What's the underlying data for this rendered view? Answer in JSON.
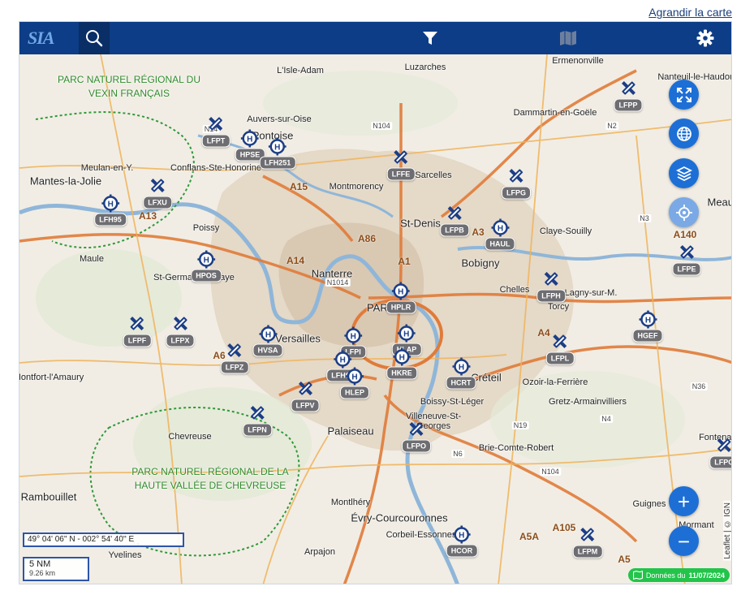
{
  "header": {
    "enlarge_link": "Agrandir la carte",
    "logo_text": "SIA"
  },
  "toolbar": {
    "search_icon": "search-icon",
    "filter_icon": "filter-icon",
    "map_icon": "map-icon",
    "settings_icon": "gear-icon"
  },
  "map": {
    "coordinates": "49° 04' 06'' N - 002° 54' 40'' E",
    "scale_nm": "5 NM",
    "scale_km": "9.26 km",
    "data_badge_prefix": "Données du",
    "data_badge_date": "11/07/2024",
    "attribution": "Leaflet | © IGN",
    "controls": {
      "fullscreen": "expand-icon",
      "globe": "globe-icon",
      "layers": "layers-icon",
      "locate": "locate-icon",
      "zoom_in": "+",
      "zoom_out": "−"
    },
    "aerodromes": [
      {
        "code": "LFPT",
        "kind": "airport"
      },
      {
        "code": "HPSE",
        "kind": "heliport"
      },
      {
        "code": "LFH251",
        "kind": "heliport"
      },
      {
        "code": "LFFE",
        "kind": "airport"
      },
      {
        "code": "LFPP",
        "kind": "airport"
      },
      {
        "code": "LFPG",
        "kind": "airport"
      },
      {
        "code": "LFXU",
        "kind": "airport"
      },
      {
        "code": "LFH95",
        "kind": "heliport"
      },
      {
        "code": "LFPB",
        "kind": "airport"
      },
      {
        "code": "HAUL",
        "kind": "heliport"
      },
      {
        "code": "LFPE",
        "kind": "airport"
      },
      {
        "code": "HPOS",
        "kind": "heliport"
      },
      {
        "code": "HPLR",
        "kind": "heliport"
      },
      {
        "code": "LFPH",
        "kind": "airport"
      },
      {
        "code": "HGEF",
        "kind": "heliport"
      },
      {
        "code": "LFPF",
        "kind": "airport"
      },
      {
        "code": "LFPX",
        "kind": "airport"
      },
      {
        "code": "HVSA",
        "kind": "heliport"
      },
      {
        "code": "LFPI",
        "kind": "heliport"
      },
      {
        "code": "HLAP",
        "kind": "heliport"
      },
      {
        "code": "LFPL",
        "kind": "airport"
      },
      {
        "code": "LFPZ",
        "kind": "airport"
      },
      {
        "code": "LFH66",
        "kind": "heliport"
      },
      {
        "code": "HKRE",
        "kind": "heliport"
      },
      {
        "code": "HCRT",
        "kind": "heliport"
      },
      {
        "code": "HLEP",
        "kind": "heliport"
      },
      {
        "code": "LFPV",
        "kind": "airport"
      },
      {
        "code": "LFPN",
        "kind": "airport"
      },
      {
        "code": "LFPO",
        "kind": "airport"
      },
      {
        "code": "HCOR",
        "kind": "heliport"
      },
      {
        "code": "LFPM",
        "kind": "airport"
      },
      {
        "code": "LFPC",
        "kind": "airport"
      }
    ],
    "places": [
      "L'Isle-Adam",
      "Luzarches",
      "Ermenonville",
      "Nanteuil-le-Haudouin",
      "Auvers-sur-Oise",
      "Pontoise",
      "Dammartin-en-Goële",
      "Conflans-Ste-Honorine",
      "Meulan-en-Y.",
      "Mantes-la-Jolie",
      "Sarcelles",
      "Montmorency",
      "St-Denis",
      "Poissy",
      "Claye-Souilly",
      "Maule",
      "Bobigny",
      "Nanterre",
      "St-Germain-en-Laye",
      "PARIS",
      "Chelles",
      "Torcy",
      "Lagny-sur-M.",
      "Versailles",
      "Créteil",
      "Ozoir-la-Ferrière",
      "Gretz-Armainvilliers",
      "Boissy-St-Léger",
      "Villeneuve-St-Georges",
      "Palaiseau",
      "Chevreuse",
      "Brie-Comte-Robert",
      "Rambouillet",
      "Montlhéry",
      "Évry-Courcouronnes",
      "Corbeil-Essonnes",
      "Arpajon",
      "Yvelines",
      "Guignes",
      "Mormant",
      "Montfort-l'Amaury",
      "Meaux",
      "Fontenay"
    ],
    "parks": [
      "PARC NATUREL RÉGIONAL DU VEXIN FRANÇAIS",
      "PARC NATUREL RÉGIONAL DE LA HAUTE VALLÉE DE CHEVREUSE"
    ],
    "roads": [
      "N14",
      "N104",
      "N2",
      "A15",
      "A13",
      "A86",
      "A14",
      "A1",
      "A3",
      "N1014",
      "N3",
      "A140",
      "A4",
      "N36",
      "N4",
      "A6",
      "N19",
      "N6",
      "N104",
      "A105",
      "A5A",
      "A5"
    ]
  }
}
